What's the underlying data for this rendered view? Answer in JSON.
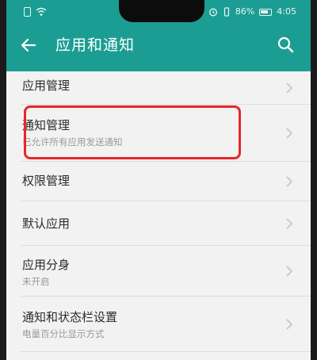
{
  "status_bar": {
    "battery_percent": "86%",
    "time": "4:05"
  },
  "header": {
    "title": "应用和通知",
    "back_icon": "arrow-left-icon",
    "search_icon": "search-icon"
  },
  "settings": {
    "items": [
      {
        "label": "应用管理",
        "sublabel": ""
      },
      {
        "label": "通知管理",
        "sublabel": "已允许所有应用发送通知"
      },
      {
        "label": "权限管理",
        "sublabel": ""
      },
      {
        "label": "默认应用",
        "sublabel": ""
      },
      {
        "label": "应用分身",
        "sublabel": "未开启"
      },
      {
        "label": "通知和状态栏设置",
        "sublabel": "电量百分比显示方式"
      }
    ]
  },
  "colors": {
    "accent": "#1c9d93",
    "highlight": "#e8262a",
    "background": "#f2f2f2"
  }
}
